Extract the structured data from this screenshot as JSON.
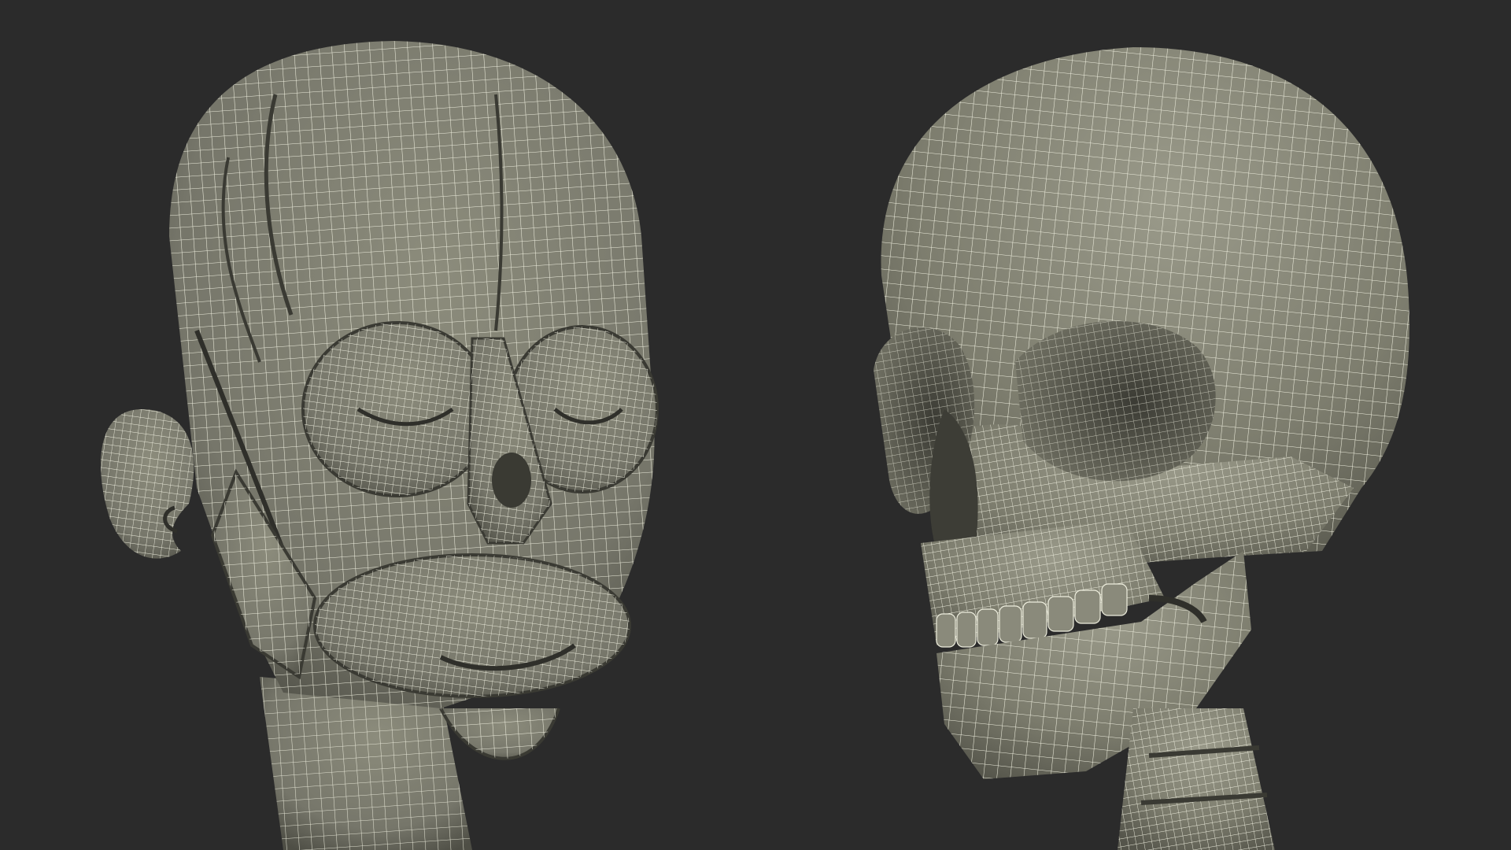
{
  "scene": {
    "background": "#2b2b2b",
    "surface_color": "#7d7d6e",
    "surface_shadow": "#55554b",
    "surface_highlight": "#9a9a8a",
    "wire_color": "#eeeede"
  },
  "renders": [
    {
      "id": "muscle-head",
      "subject": "facial-muscle-head-icon"
    },
    {
      "id": "skull",
      "subject": "skull-icon"
    }
  ]
}
